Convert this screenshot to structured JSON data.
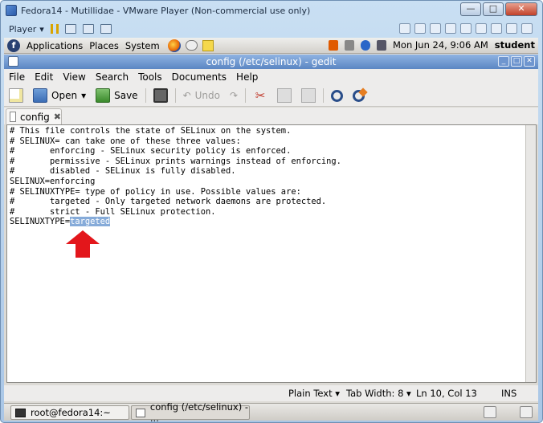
{
  "vm": {
    "title": "Fedora14 - Mutillidae - VMware Player (Non-commercial use only)",
    "player_label": "Player"
  },
  "panel": {
    "items": [
      "Applications",
      "Places",
      "System"
    ],
    "clock": "Mon Jun 24,  9:06 AM",
    "user": "student"
  },
  "gedit": {
    "title": "config (/etc/selinux) - gedit",
    "menu": [
      "File",
      "Edit",
      "View",
      "Search",
      "Tools",
      "Documents",
      "Help"
    ],
    "toolbar": {
      "open": "Open",
      "save": "Save",
      "undo": "Undo"
    },
    "tab": {
      "label": "config",
      "close": "✖"
    },
    "lines": [
      "# This file controls the state of SELinux on the system.",
      "# SELINUX= can take one of these three values:",
      "#       enforcing - SELinux security policy is enforced.",
      "#       permissive - SELinux prints warnings instead of enforcing.",
      "#       disabled - SELinux is fully disabled.",
      "SELINUX=enforcing",
      "# SELINUXTYPE= type of policy in use. Possible values are:",
      "#       targeted - Only targeted network daemons are protected.",
      "#       strict - Full SELinux protection."
    ],
    "last_line": {
      "prefix": "SELINUXTYPE=",
      "selected": "targeted"
    },
    "status": {
      "syntax": "Plain Text ▾",
      "tab_width": "Tab Width:  8 ▾",
      "position": "Ln 10, Col 13",
      "mode": "INS"
    }
  },
  "taskbar": {
    "tasks": [
      "root@fedora14:~",
      "config (/etc/selinux) - ..."
    ]
  },
  "colors": {
    "selection": "#86abd9",
    "arrow": "#e3161b",
    "gedit_title": "#6f96cf"
  }
}
